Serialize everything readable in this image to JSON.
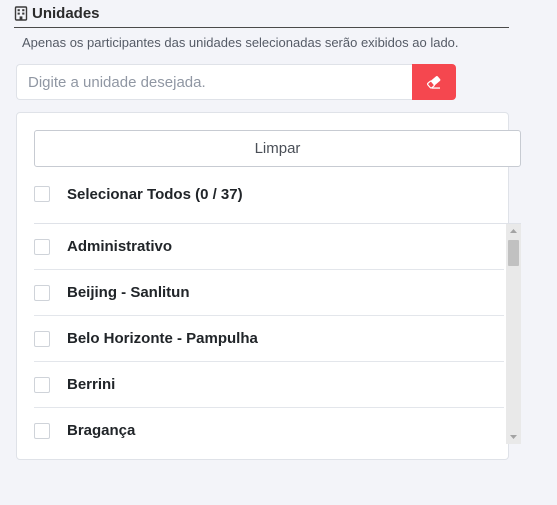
{
  "header": {
    "title": "Unidades",
    "icon": "building-icon"
  },
  "subtitle": "Apenas os participantes das unidades selecionadas serão exibidos ao lado.",
  "search": {
    "placeholder": "Digite a unidade desejada.",
    "value": "",
    "clear_icon": "eraser-icon",
    "clear_color": "#f5474f"
  },
  "panel": {
    "clear_label": "Limpar",
    "select_all_label": "Selecionar Todos (0 / 37)",
    "items": [
      {
        "label": "Administrativo",
        "checked": false
      },
      {
        "label": "Beijing - Sanlitun",
        "checked": false
      },
      {
        "label": "Belo Horizonte - Pampulha",
        "checked": false
      },
      {
        "label": "Berrini",
        "checked": false
      },
      {
        "label": "Bragança",
        "checked": false
      }
    ]
  }
}
